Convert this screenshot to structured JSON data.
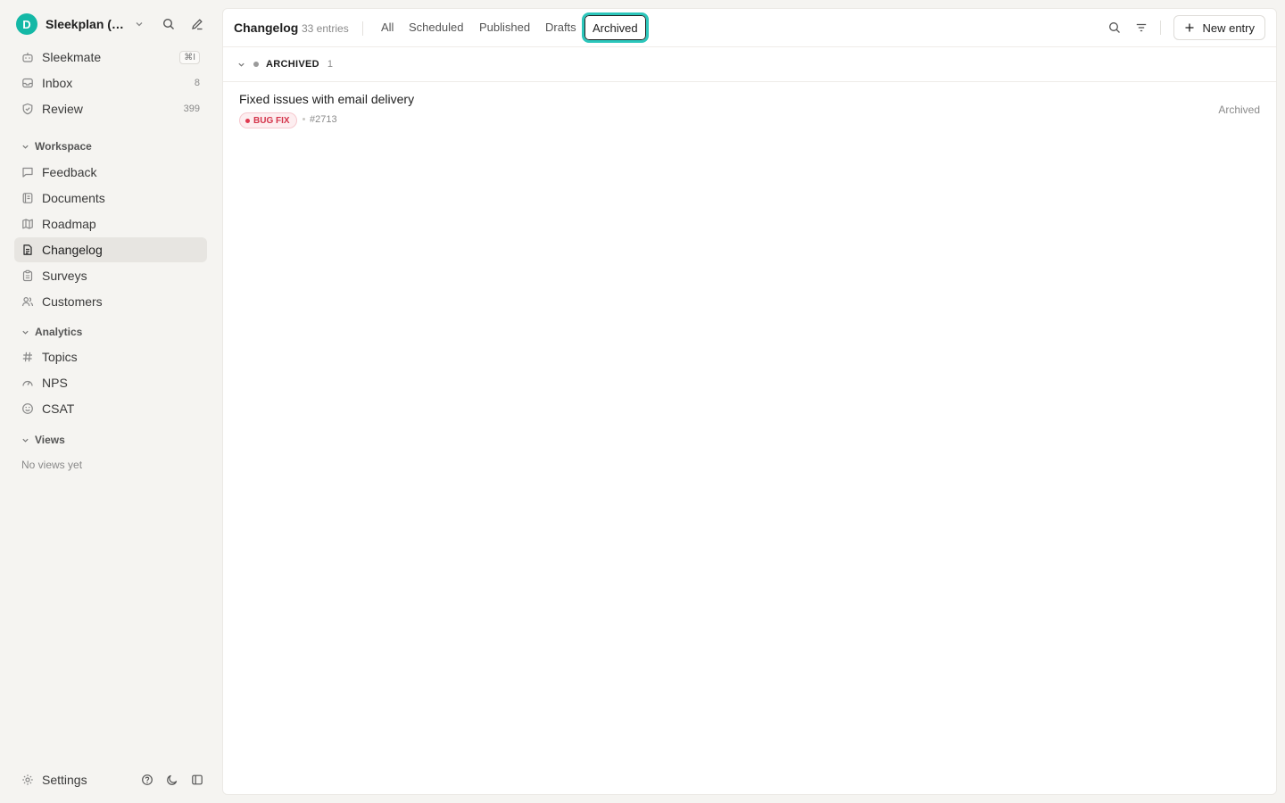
{
  "workspace": {
    "avatar_letter": "D",
    "name": "Sleekplan (D..."
  },
  "sidebar": {
    "top_items": [
      {
        "label": "Sleekmate",
        "shortcut": "⌘I"
      },
      {
        "label": "Inbox",
        "count": "8"
      },
      {
        "label": "Review",
        "count": "399"
      }
    ],
    "sections": {
      "workspace": {
        "label": "Workspace",
        "items": [
          "Feedback",
          "Documents",
          "Roadmap",
          "Changelog",
          "Surveys",
          "Customers"
        ]
      },
      "analytics": {
        "label": "Analytics",
        "items": [
          "Topics",
          "NPS",
          "CSAT"
        ]
      },
      "views": {
        "label": "Views",
        "empty_text": "No views yet"
      }
    },
    "active_item": "Changelog",
    "settings_label": "Settings"
  },
  "header": {
    "title": "Changelog",
    "count": "33 entries",
    "tabs": [
      "All",
      "Scheduled",
      "Published",
      "Drafts",
      "Archived"
    ],
    "active_tab": "Archived",
    "new_entry_label": "New entry"
  },
  "group": {
    "label": "ARCHIVED",
    "count": "1"
  },
  "entries": [
    {
      "title": "Fixed issues with email delivery",
      "tag": "BUG FIX",
      "id": "#2713",
      "status": "Archived"
    }
  ],
  "colors": {
    "accent": "#14b8a6",
    "focus_ring": "#2cc6bb",
    "bug_tag": "#d4334a"
  }
}
